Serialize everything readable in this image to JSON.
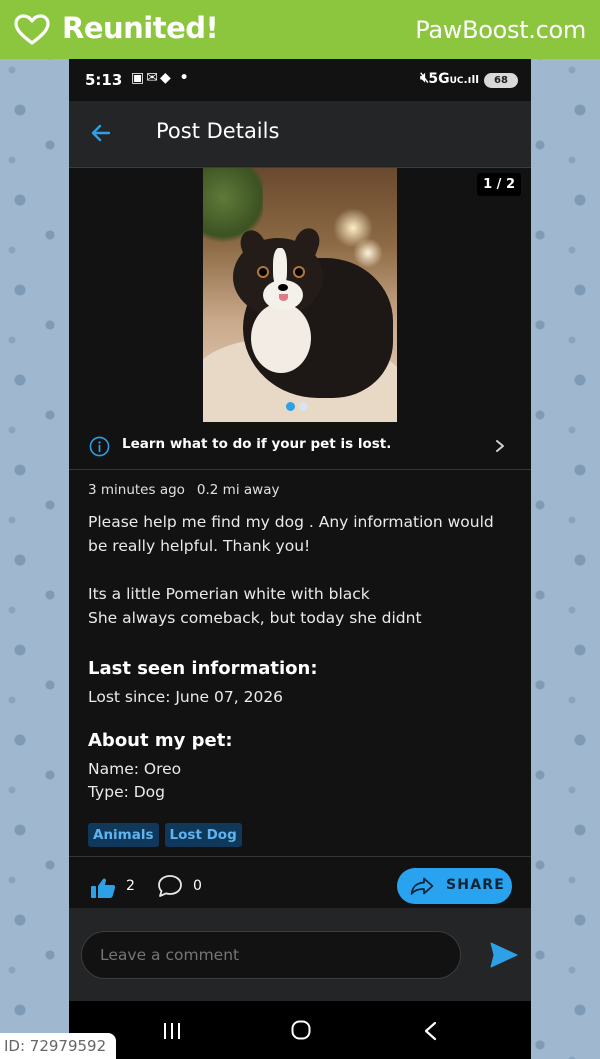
{
  "banner": {
    "reunited": "Reunited!",
    "brand": "PawBoost.com",
    "background": "#8cc63f"
  },
  "status_bar": {
    "time": "5:13",
    "network": "5G",
    "network_sub": "UC",
    "battery": "68"
  },
  "app_bar": {
    "title": "Post Details",
    "icon": "arrow-back-icon",
    "accent": "#2ea0e6"
  },
  "gallery": {
    "counter": "1 / 2",
    "current_index": 1,
    "total": 2
  },
  "learn_banner": {
    "text": "Learn what to do if your pet is lost.",
    "icon": "info-icon"
  },
  "post": {
    "posted_ago": "3 minutes ago",
    "distance": "0.2 mi away",
    "message_p1": "Please help me find my dog . Any information would be really helpful. Thank you!",
    "message_p2": "Its a little Pomerian white with black\nShe always comeback, but today she didnt"
  },
  "last_seen": {
    "heading": "Last seen information:",
    "lost_since": "Lost since: June 07, 2026"
  },
  "about_pet": {
    "heading": "About my pet:",
    "name": "Name: Oreo",
    "type": "Type: Dog"
  },
  "tags": [
    "Animals",
    "Lost Dog"
  ],
  "actions": {
    "likes": "2",
    "comments": "0",
    "share_label": "SHARE",
    "share_color": "#29a3f0"
  },
  "comment": {
    "placeholder": "Leave a comment"
  },
  "watermark": {
    "id": "ID: 72979592"
  }
}
